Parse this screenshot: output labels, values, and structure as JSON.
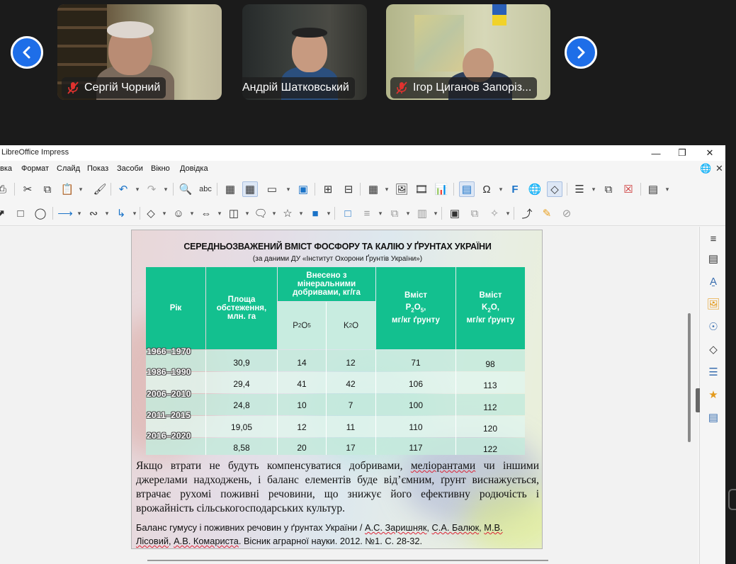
{
  "conference": {
    "participants": [
      {
        "name": "Сергій Чорний",
        "muted": true
      },
      {
        "name": "Андрій Шатковський",
        "muted": true
      },
      {
        "name": "Ігор Циганов Запоріз...",
        "muted": true
      }
    ],
    "accent": "#1e6ee8"
  },
  "window": {
    "title": "LibreOffice Impress"
  },
  "menu": {
    "items": [
      "вка",
      "Формат",
      "Слайд",
      "Показ",
      "Засоби",
      "Вікно",
      "Довідка"
    ]
  },
  "slide": {
    "title": "СЕРЕДНЬОЗВАЖЕНИЙ ВМІСТ ФОСФОРУ ТА КАЛІЮ У ҐРУНТАХ УКРАЇНИ",
    "subtitle": "(за даними ДУ «Інститут Охорони Ґрунтів України»)",
    "table": {
      "header_color": "#13c08f",
      "col_year": "Рік",
      "col_area": "Площа обстеження, млн. га",
      "col_fert": "Внесено з мінеральними добривами, кг/га",
      "col_p2o5_sub": "P2O5",
      "col_k2o_sub": "K2O",
      "col_p_content": "Вміст P2O5, мг/кг ґрунту",
      "col_k_content": "Вміст K2O, мг/кг ґрунту",
      "rows": [
        {
          "year": "1966–1970",
          "area": "30,9",
          "p_fert": "14",
          "k_fert": "12",
          "p_content": "71",
          "k_content": "98"
        },
        {
          "year": "1986–1990",
          "area": "29,4",
          "p_fert": "41",
          "k_fert": "42",
          "p_content": "106",
          "k_content": "113"
        },
        {
          "year": "2006–2010",
          "area": "24,8",
          "p_fert": "10",
          "k_fert": "7",
          "p_content": "100",
          "k_content": "112"
        },
        {
          "year": "2011–2015",
          "area": "19,05",
          "p_fert": "12",
          "k_fert": "11",
          "p_content": "110",
          "k_content": "120"
        },
        {
          "year": "2016–2020",
          "area": "8,58",
          "p_fert": "20",
          "k_fert": "17",
          "p_content": "117",
          "k_content": "122"
        }
      ]
    },
    "body_pre": "Якщо втрати не будуть компенсуватися добривами, ",
    "body_spell": "меліорантами",
    "body_post": " чи іншими джерелами надходжень, і баланс елементів буде від’ємним, ґрунт виснажується, втрачає рухомі поживні речовини, що знижує його ефективну родючість і врожайність сільськогосподарських культур.",
    "ref_a": "Баланс гумусу і поживних речовин у ґрунтах України / ",
    "ref_b": "А.С. Заришняк",
    "ref_c": ", ",
    "ref_d": "С.А. Балюк",
    "ref_e": ", ",
    "ref_f": "М.В. Лісовий",
    "ref_g": ", ",
    "ref_h": "А.В. Комариста",
    "ref_i": ". Вісник аграрної науки. 2012. №1. С. 28-32."
  }
}
